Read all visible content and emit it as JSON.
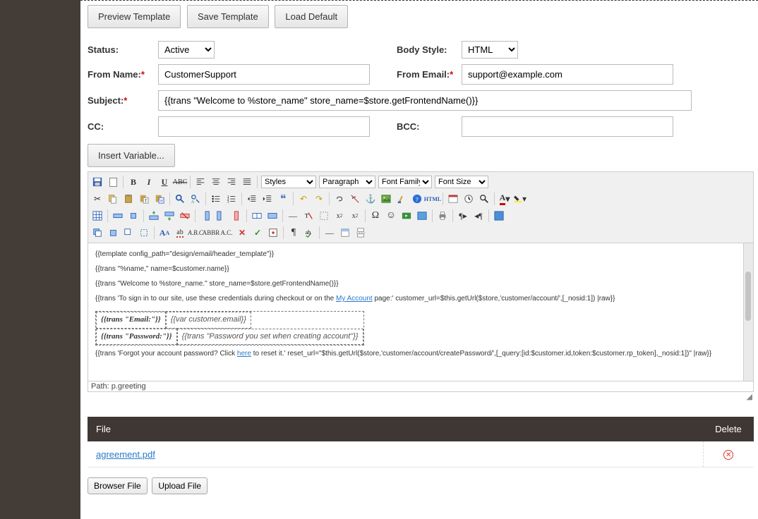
{
  "buttons": {
    "preview": "Preview Template",
    "save": "Save Template",
    "load_default": "Load Default",
    "insert_variable": "Insert Variable...",
    "browse_file": "Browser File",
    "upload_file": "Upload File"
  },
  "labels": {
    "status": "Status:",
    "body_style": "Body Style:",
    "from_name": "From Name:",
    "from_email": "From Email:",
    "subject": "Subject:",
    "cc": "CC:",
    "bcc": "BCC:"
  },
  "values": {
    "status": "Active",
    "body_style": "HTML",
    "from_name": "CustomerSupport",
    "from_email": "support@example.com",
    "subject": "{{trans \"Welcome to %store_name\" store_name=$store.getFrontendName()}}",
    "cc": "",
    "bcc": ""
  },
  "toolbar": {
    "styles": "Styles",
    "format": "Paragraph",
    "font_family": "Font Family",
    "font_size": "Font Size"
  },
  "editor_html": {
    "l1": "{{template config_path=\"design/email/header_template\"}}",
    "l2": "{{trans \"%name,\" name=$customer.name}}",
    "l3": "{{trans \"Welcome to %store_name.\" store_name=$store.getFrontendName()}}",
    "l4a": "{{trans 'To sign in to our site, use these credentials during checkout or on the ",
    "l4_link": "My Account",
    "l4b": " page:' customer_url=$this.getUrl($store,'customer/account/',[_nosid:1]) |raw}}",
    "cred_email_label": "{{trans \"Email:\"}}",
    "cred_email_value": "{{var customer.email}}",
    "cred_pwd_label": "{{trans \"Password:\"}}",
    "cred_pwd_value": "{{trans \"Password you set when creating account\"}}",
    "l5a": "{{trans 'Forgot your account password? Click ",
    "l5_link": "here",
    "l5b": " to reset it.' reset_url=\"$this.getUrl($store,'customer/account/createPassword/',[_query:[id:$customer.id,token:$customer.rp_token],_nosid:1])\" |raw}}"
  },
  "editor_path": "Path: p.greeting",
  "file_table": {
    "header_file": "File",
    "header_delete": "Delete",
    "rows": [
      {
        "name": "agreement.pdf"
      }
    ]
  }
}
